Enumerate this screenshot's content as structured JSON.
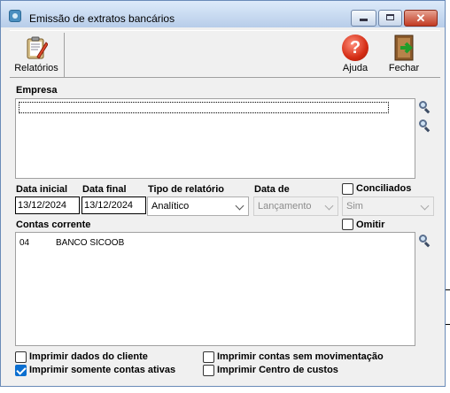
{
  "window": {
    "title": "Emissão de extratos bancários"
  },
  "toolbar": {
    "relatorios_label": "Relatórios",
    "ajuda_label": "Ajuda",
    "fechar_label": "Fechar"
  },
  "empresa": {
    "label": "Empresa"
  },
  "filters": {
    "data_inicial_label": "Data inicial",
    "data_inicial_value": "13/12/2024",
    "data_final_label": "Data final",
    "data_final_value": "13/12/2024",
    "tipo_label": "Tipo de relatório",
    "tipo_value": "Analítico",
    "data_de_label": "Data de",
    "data_de_value": "Lançamento",
    "conciliados_label": "Conciliados",
    "conciliados_value": "Sim",
    "omitir_label": "Omitir"
  },
  "contas": {
    "label": "Contas corrente",
    "rows": [
      {
        "code": "04",
        "name": "BANCO SICOOB"
      }
    ]
  },
  "options": {
    "imprimir_dados_cliente": "Imprimir dados do cliente",
    "imprimir_somente_ativas": "Imprimir somente contas ativas",
    "imprimir_sem_movimentacao": "Imprimir contas sem movimentação",
    "imprimir_centro_custos": "Imprimir Centro de custos"
  },
  "colors": {
    "title_bar": "#c9dcf2",
    "close_button": "#c7432b",
    "checkbox_checked": "#0b6fd0",
    "help_icon": "#d42c14"
  }
}
